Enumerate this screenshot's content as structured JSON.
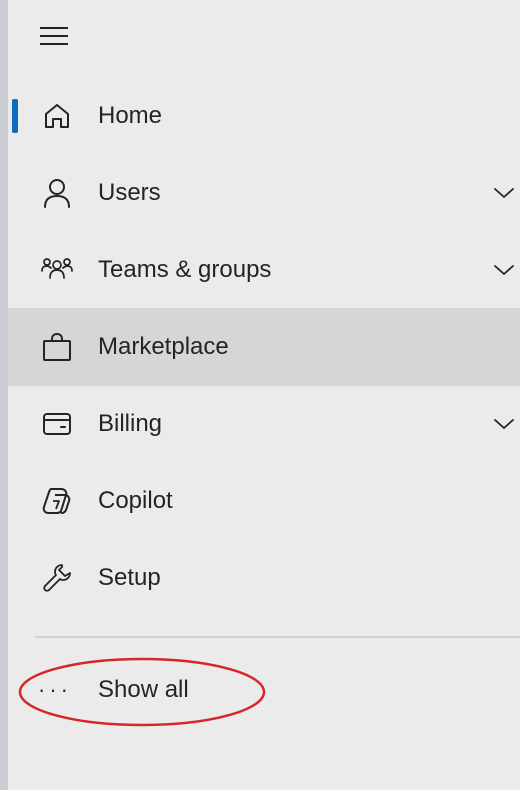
{
  "nav": {
    "menu_icon": "hamburger-menu-icon",
    "items": [
      {
        "label": "Home",
        "icon": "home-icon",
        "active": true,
        "expandable": false
      },
      {
        "label": "Users",
        "icon": "person-icon",
        "active": false,
        "expandable": true
      },
      {
        "label": "Teams & groups",
        "icon": "people-team-icon",
        "active": false,
        "expandable": true
      },
      {
        "label": "Marketplace",
        "icon": "shopping-bag-icon",
        "active": false,
        "expandable": false,
        "highlighted": true
      },
      {
        "label": "Billing",
        "icon": "wallet-card-icon",
        "active": false,
        "expandable": true
      },
      {
        "label": "Copilot",
        "icon": "copilot-icon",
        "active": false,
        "expandable": false
      },
      {
        "label": "Setup",
        "icon": "wrench-icon",
        "active": false,
        "expandable": false
      }
    ],
    "show_all": {
      "label": "Show all",
      "icon": "more-horizontal-icon",
      "ellipsis": "···"
    }
  },
  "colors": {
    "background": "#ebebeb",
    "highlight": "#d6d6d6",
    "active_indicator": "#0f6cbd",
    "annotation": "#d6262b",
    "text": "#242424"
  }
}
